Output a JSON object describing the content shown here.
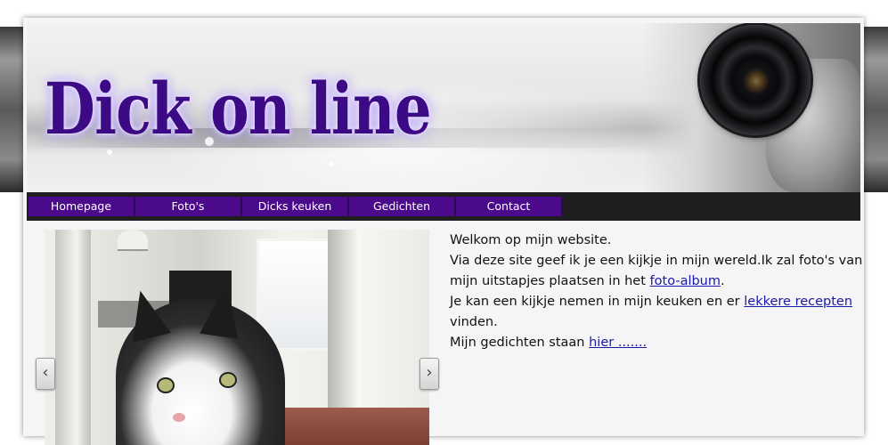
{
  "site": {
    "title": "Dick on line"
  },
  "nav": {
    "items": [
      {
        "label": "Homepage"
      },
      {
        "label": "Foto's"
      },
      {
        "label": "Dicks keuken"
      },
      {
        "label": "Gedichten"
      },
      {
        "label": "Contact"
      }
    ]
  },
  "slideshow": {
    "prev_icon": "chevron-left-icon",
    "next_icon": "chevron-right-icon",
    "prev_glyph": "‹",
    "next_glyph": "›"
  },
  "content": {
    "line1": "Welkom op mijn website.",
    "line2": "Via deze site geef ik je een kijkje in mijn wereld.Ik zal foto's van mijn uitstapjes plaatsen in het ",
    "line2_link": "foto-album",
    "line2_end": ".",
    "line3": "Je kan een kijkje nemen in mijn keuken en er ",
    "line3_link": "lekkere recepten",
    "line3_end": " vinden.",
    "line4": "Mijn gedichten staan ",
    "line4_link": "hier ......."
  },
  "colors": {
    "title": "#3d0a86",
    "nav_item": "#4b0a8c",
    "nav_bar": "#1e1e20",
    "link": "#1a1aa6"
  }
}
